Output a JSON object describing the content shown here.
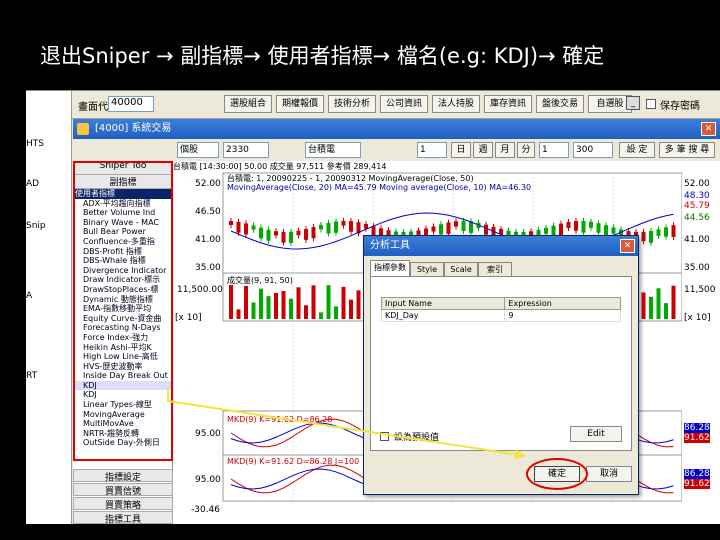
{
  "slide": {
    "title": "退出Sniper → 副指標→ 使用者指標→ 檔名(e.g: KDJ)→ 確定"
  },
  "app": {
    "code_label": "畫面代碼",
    "code_value": "40000",
    "toolbar_buttons": [
      "選股組合",
      "期權報價",
      "技術分析",
      "公司資訊",
      "法人持股",
      "庫存資訊",
      "盤後交易",
      "自選股"
    ],
    "checkbox_label": "保存密碼",
    "window_title": "[4000] 系統交易",
    "left_strip": [
      "HTS",
      "AD",
      "Snip",
      "A",
      "RT"
    ]
  },
  "controls": {
    "stock_select": "個股",
    "stock_code": "2330",
    "stock_name": "台積電",
    "period_count": "1",
    "period_unit": "日",
    "period_week": "週",
    "period_month": "月",
    "min_label": "分",
    "tick_value": "1",
    "bars_value": "300",
    "settings_btn": "設 定",
    "multi_btn": "多 筆 搜 尋"
  },
  "indicator_panel": {
    "header1": "Sniper Too",
    "header2": "副指標",
    "items": [
      {
        "label": "使用者指標",
        "type": "group"
      },
      {
        "label": "ADX-平均趨向指標",
        "type": "item"
      },
      {
        "label": "Better Volume Ind",
        "type": "item"
      },
      {
        "label": "Binary Wave - MAC",
        "type": "item"
      },
      {
        "label": "Bull Bear Power",
        "type": "item"
      },
      {
        "label": "Confluence-多重指",
        "type": "item"
      },
      {
        "label": "DBS-Profit 指標",
        "type": "item"
      },
      {
        "label": "DBS-Whale 指標",
        "type": "item"
      },
      {
        "label": "Divergence Indicator",
        "type": "item"
      },
      {
        "label": "Draw Indicator-標示",
        "type": "item"
      },
      {
        "label": "DrawStopPlaces-標",
        "type": "item"
      },
      {
        "label": "Dynamic 動態指標",
        "type": "item"
      },
      {
        "label": "EMA-指數移動平均",
        "type": "item"
      },
      {
        "label": "Equity Curve-資金曲",
        "type": "item"
      },
      {
        "label": "Forecasting N-Days",
        "type": "item"
      },
      {
        "label": "Force Index-強力",
        "type": "item"
      },
      {
        "label": "Heikin Ashi-平均K",
        "type": "item"
      },
      {
        "label": "High Low Line-高低",
        "type": "item"
      },
      {
        "label": "HVS-歷史波動率",
        "type": "item"
      },
      {
        "label": "Inside Day Break Out",
        "type": "item"
      },
      {
        "label": "KDJ",
        "type": "selected"
      },
      {
        "label": "KDJ",
        "type": "item"
      },
      {
        "label": "Linear Types-線型",
        "type": "item"
      },
      {
        "label": "MovingAverage",
        "type": "item"
      },
      {
        "label": "MultiMovAve",
        "type": "item"
      },
      {
        "label": "NRTR-趨勢反轉",
        "type": "item"
      },
      {
        "label": "OutSide Day-外側日",
        "type": "item"
      }
    ],
    "bottom_buttons": [
      "指標設定",
      "買賣信號",
      "買賣策略",
      "指標工具"
    ]
  },
  "chart": {
    "header": "台積電   [14:30:00]   50.00  成交量  97,511   參考價  289,414",
    "legend1": "台積電: 1, 20090225 - 1, 20090312  MovingAverage(Close, 50)",
    "legend2": "MovingAverage(Close, 20)  MA=45.79  Moving average(Close, 10)  MA=46.30",
    "legend3": "成交量(9, 91, 50)",
    "kd_legend": "MKD(9)  K=91.62  D=86.28",
    "kd_legend2": "MKD(9)  K=91.62  D=86.28  J=100",
    "left_ticks": [
      "52.00",
      "46.50",
      "41.00",
      "35.00",
      "11,500.00",
      "[x 10]",
      "95.00",
      "95.00",
      "-30.46"
    ],
    "right_ticks": [
      "52.00",
      "48.30",
      "45.79",
      "44.56",
      "41.00",
      "35.00",
      "11,500",
      "[x 10]",
      "86.28",
      "91.62",
      "86.28",
      "91.62"
    ],
    "colors": {
      "up": "#cc0000",
      "down": "#00aa00",
      "ma": "#0000cc",
      "kline": "#cc0000",
      "dline": "#0000cc"
    }
  },
  "dialog": {
    "title": "分析工具",
    "tabs": [
      "指標參數",
      "Style",
      "Scale",
      "索引"
    ],
    "col_input": "Input Name",
    "col_expr": "Expression",
    "row_name": "KDJ_Day",
    "row_value": "9",
    "checkbox_label": "設為預設值",
    "edit_label": "Edit",
    "ok_label": "確定",
    "cancel_label": "取消"
  }
}
